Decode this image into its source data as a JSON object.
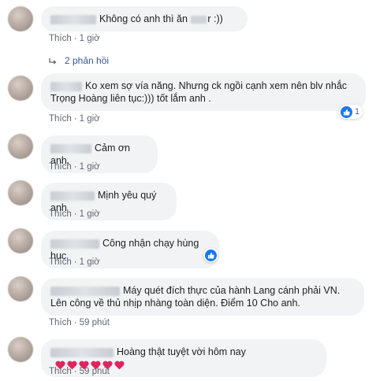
{
  "comments": [
    {
      "text_pre": "Không có anh thì ăn",
      "text_post": "r :))",
      "like": "Thích",
      "time": "1 giờ"
    },
    {
      "text": "Ko xem sợ vía năng. Nhưng ck ngồi cạnh xem nên blv nhắc Trọng Hoàng liên tục:))) tốt lắm anh .",
      "like": "Thích",
      "time": "1 giờ",
      "reaction_count": "1"
    },
    {
      "text": "Cảm ơn anh.",
      "like": "Thích",
      "time": "1 giờ"
    },
    {
      "text": "Mịnh yêu quý anh",
      "like": "Thích",
      "time": "1 giờ"
    },
    {
      "text": "Công nhận chạy hùng hục",
      "like": "Thích",
      "time": "1 giờ"
    },
    {
      "text": "Máy quét đích thực của hành Lang cánh phải VN. Lên công về thủ nhịp nhàng toàn diện. Điểm 10 Cho anh.",
      "like": "Thích",
      "time": "59 phút"
    },
    {
      "text": "Hoàng thật tuyệt vời hôm nay",
      "like": "Thích",
      "time": "59 phút"
    }
  ],
  "replies": {
    "label": "2 phản hồi"
  },
  "reaction_count_5": "",
  "colors": {
    "link": "#385898",
    "bubble": "#f2f3f5",
    "like_blue": "#1877f2",
    "heart": "#e0245e"
  }
}
